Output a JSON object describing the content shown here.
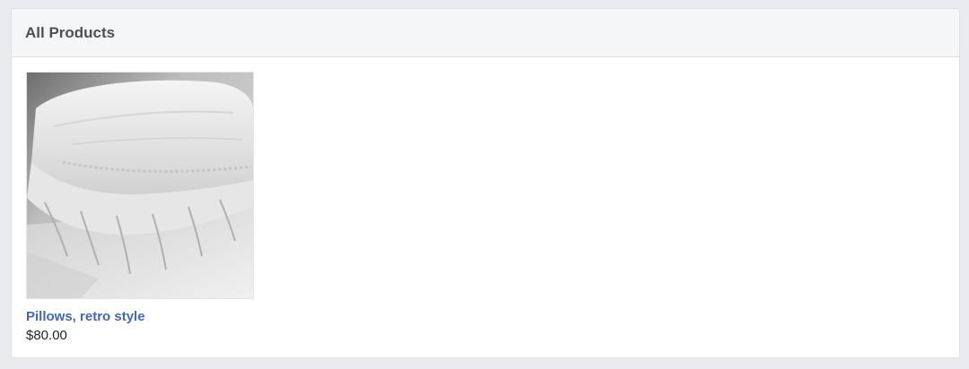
{
  "panel": {
    "title": "All Products"
  },
  "products": [
    {
      "name": "Pillows, retro style",
      "price": "$80.00",
      "image_icon": "pillow-photo"
    }
  ],
  "colors": {
    "page_background": "#e9ebee",
    "header_background": "#f5f6f7",
    "link": "#4267b2",
    "text": "#1d2129"
  }
}
